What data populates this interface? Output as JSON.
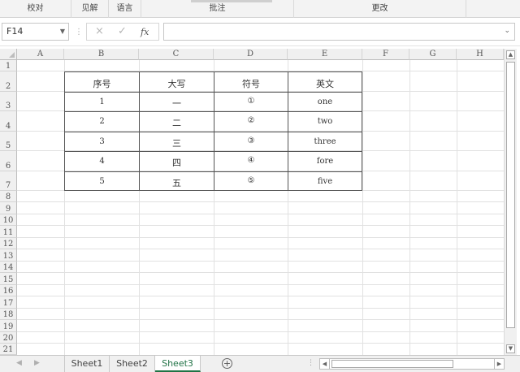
{
  "ribbon": {
    "groups": [
      "校对",
      "见解",
      "语言",
      "批注",
      "更改"
    ]
  },
  "formula_bar": {
    "name_box": "F14",
    "formula": "",
    "icons": {
      "cancel": "×",
      "enter": "✓",
      "fx": "fx"
    }
  },
  "grid": {
    "columns": [
      "A",
      "B",
      "C",
      "D",
      "E",
      "F",
      "G",
      "H"
    ],
    "rows": [
      "1",
      "2",
      "3",
      "4",
      "5",
      "6",
      "7",
      "8",
      "9",
      "10",
      "11",
      "12",
      "13",
      "14",
      "15",
      "16",
      "17",
      "18",
      "19",
      "20",
      "21"
    ],
    "table": {
      "headers": [
        "序号",
        "大写",
        "符号",
        "英文"
      ],
      "rows": [
        [
          "1",
          "一",
          "①",
          "one"
        ],
        [
          "2",
          "二",
          "②",
          "two"
        ],
        [
          "3",
          "三",
          "③",
          "three"
        ],
        [
          "4",
          "四",
          "④",
          "fore"
        ],
        [
          "5",
          "五",
          "⑤",
          "five"
        ]
      ]
    }
  },
  "sheets": {
    "tabs": [
      "Sheet1",
      "Sheet2",
      "Sheet3"
    ],
    "active": "Sheet3",
    "add_icon": "+"
  },
  "colors": {
    "active_tab": "#217346",
    "header_bg": "#f0f0f0",
    "gridline": "#e1e1e1"
  }
}
